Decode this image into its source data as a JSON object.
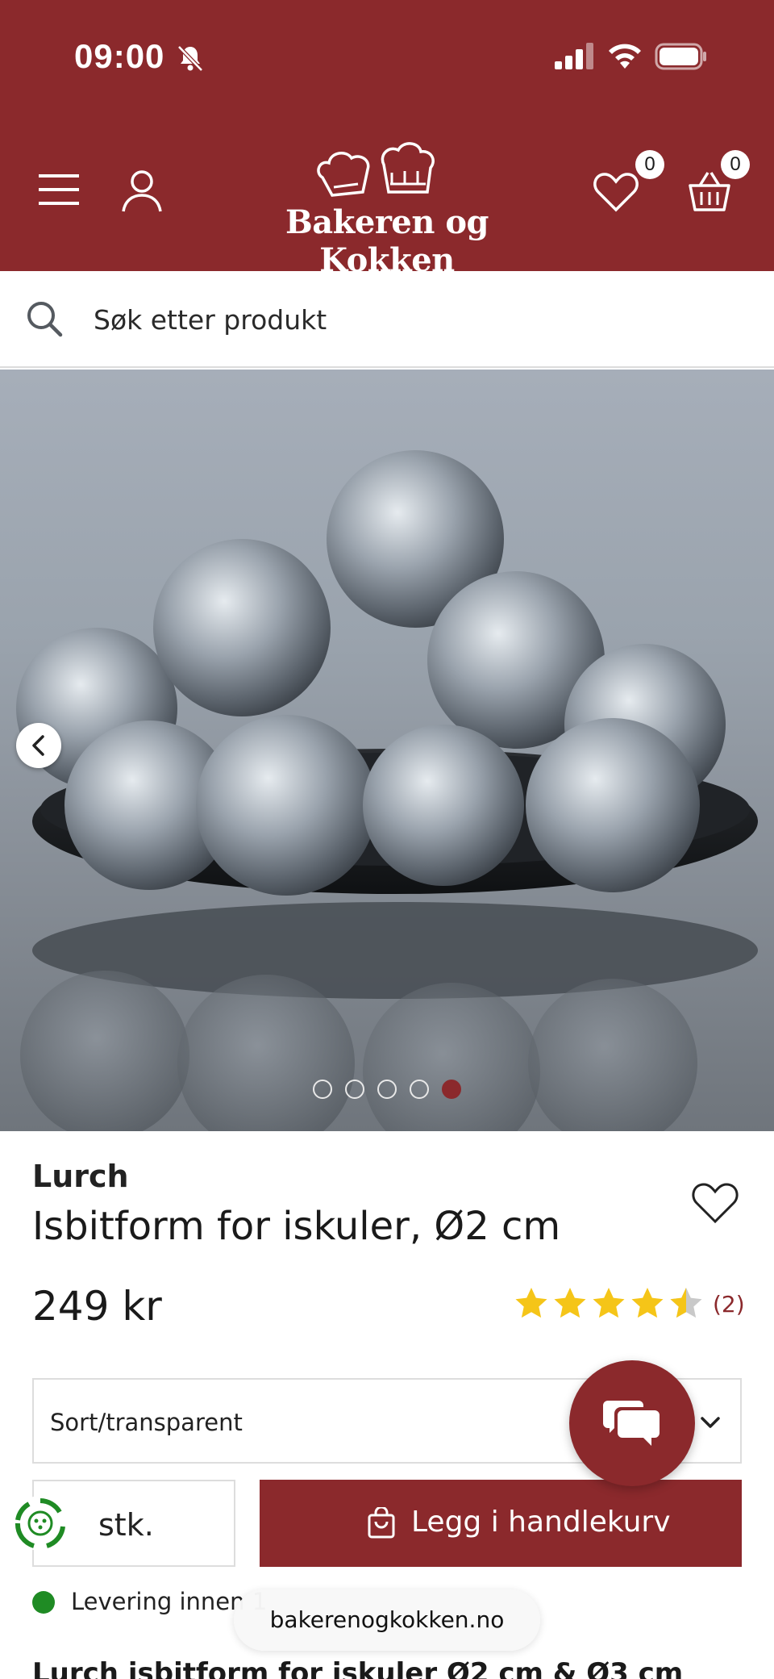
{
  "status_bar": {
    "time": "09:00",
    "icons": [
      "bell-slash-icon",
      "cellular-signal-icon",
      "wifi-icon",
      "battery-icon"
    ]
  },
  "header": {
    "logo_text": "Bakeren og Kokken",
    "wishlist_count": "0",
    "cart_count": "0",
    "icons": [
      "hamburger-menu-icon",
      "user-icon",
      "heart-icon",
      "basket-icon"
    ]
  },
  "search": {
    "placeholder": "Søk etter produkt"
  },
  "gallery": {
    "total_images": 5,
    "active_index": 5
  },
  "product": {
    "brand": "Lurch",
    "title": "Isbitform for iskuler, Ø2 cm",
    "price": "249 kr",
    "rating": 4.5,
    "review_count": "(2)",
    "variant": "Sort/transparent",
    "quantity_unit": "stk.",
    "add_to_cart": "Legg i handlekurv",
    "delivery": "Levering innen 1"
  },
  "browser": {
    "url": "bakerenogkokken.no"
  },
  "description": {
    "heading": "Lurch isbitform for iskuler Ø2 cm & Ø3 cm"
  },
  "colors": {
    "brand": "#8b292c",
    "star": "#f5c518",
    "in_stock": "#1f8b24"
  }
}
